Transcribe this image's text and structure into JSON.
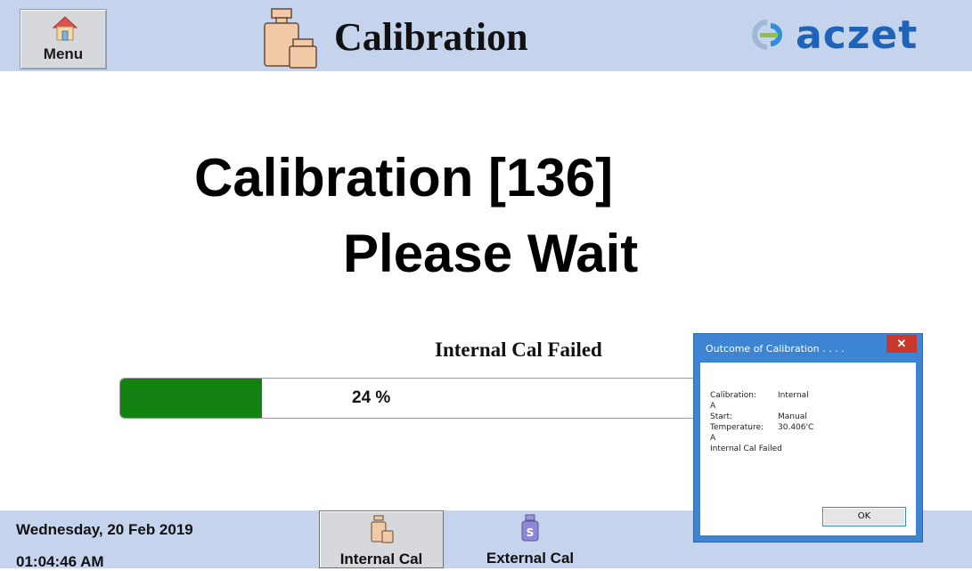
{
  "header": {
    "menu_label": "Menu",
    "title": "Calibration",
    "logo_text": "aczet",
    "menu_icon": "home-icon",
    "title_icon": "weights-icon",
    "logo_icon": "aczet-logo-icon"
  },
  "main": {
    "line1": "Calibration [136]",
    "line2": "Please Wait",
    "status": "Internal Cal Failed",
    "progress_label": "24 %",
    "progress_value": 0.24
  },
  "footer": {
    "date": "Wednesday, 20 Feb 2019",
    "time": "01:04:46 AM",
    "buttons": [
      {
        "label": "Internal Cal",
        "icon": "weights-icon",
        "active": true
      },
      {
        "label": "External Cal",
        "icon": "weight-s-icon",
        "active": false
      }
    ]
  },
  "dialog": {
    "title": "Outcome of Calibration . . . .",
    "close": "✕",
    "lines": [
      {
        "key": "Calibration:",
        "value": "Internal"
      },
      {
        "key": "A",
        "value": ""
      },
      {
        "key": "Start:",
        "value": "Manual"
      },
      {
        "key": "Temperature:",
        "value": "30.406'C"
      },
      {
        "key": "A",
        "value": ""
      },
      {
        "key": "Internal Cal Failed",
        "value": ""
      }
    ],
    "ok_label": "OK"
  },
  "colors": {
    "header_bg": "#c5d4ec",
    "progress_fill": "#138213",
    "dialog_frame": "#3d84d3",
    "close_button": "#c8382c",
    "logo": "#1e63b7"
  }
}
